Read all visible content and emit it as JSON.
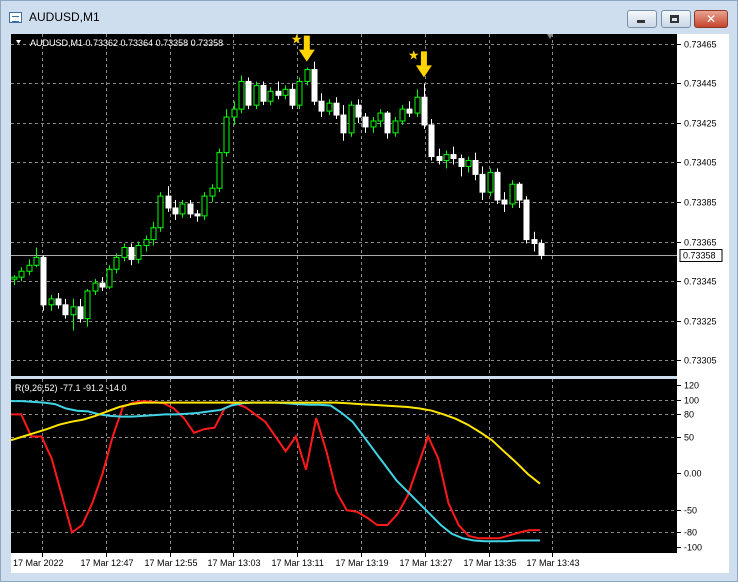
{
  "window": {
    "title": "AUDUSD,M1"
  },
  "chart_data": [
    {
      "type": "candlestick",
      "header": "AUDUSD,M1  0.73362 0.73364 0.73358 0.73358",
      "y_ticks": [
        "0.73465",
        "0.73445",
        "0.73425",
        "0.73405",
        "0.73385",
        "0.73365",
        "0.73345",
        "0.73325",
        "0.73305"
      ],
      "ylim": [
        0.73297,
        0.7347
      ],
      "current_price": "0.73358",
      "x_ticks": [
        "17 Mar 2022",
        "17 Mar 12:47",
        "17 Mar 12:55",
        "17 Mar 13:03",
        "17 Mar 13:11",
        "17 Mar 13:19",
        "17 Mar 13:27",
        "17 Mar 13:35",
        "17 Mar 13:43"
      ],
      "grid": true,
      "colors": {
        "bull": "#00ff00",
        "bear": "#ffffff",
        "bg": "#000000",
        "signal": "#ffd400"
      },
      "signals": [
        {
          "index": 40
        },
        {
          "index": 56
        }
      ],
      "candles": [
        [
          0.73346,
          0.73348,
          0.73343,
          0.73347
        ],
        [
          0.73347,
          0.73352,
          0.73345,
          0.7335
        ],
        [
          0.7335,
          0.73356,
          0.73348,
          0.73353
        ],
        [
          0.73353,
          0.73362,
          0.73352,
          0.73357
        ],
        [
          0.73357,
          0.73358,
          0.7333,
          0.73333
        ],
        [
          0.73333,
          0.73338,
          0.7333,
          0.73336
        ],
        [
          0.73336,
          0.73339,
          0.73331,
          0.73333
        ],
        [
          0.73333,
          0.73336,
          0.73326,
          0.73328
        ],
        [
          0.73328,
          0.73336,
          0.7332,
          0.73332
        ],
        [
          0.73332,
          0.73336,
          0.73324,
          0.73326
        ],
        [
          0.73326,
          0.73341,
          0.73322,
          0.7334
        ],
        [
          0.7334,
          0.73346,
          0.73338,
          0.73344
        ],
        [
          0.73344,
          0.73347,
          0.7334,
          0.73342
        ],
        [
          0.73342,
          0.73353,
          0.73341,
          0.73351
        ],
        [
          0.73351,
          0.73359,
          0.73349,
          0.73357
        ],
        [
          0.73357,
          0.73364,
          0.73355,
          0.73362
        ],
        [
          0.73362,
          0.73364,
          0.73353,
          0.73356
        ],
        [
          0.73356,
          0.73365,
          0.73354,
          0.73363
        ],
        [
          0.73363,
          0.73368,
          0.7336,
          0.73366
        ],
        [
          0.73366,
          0.73375,
          0.73363,
          0.73372
        ],
        [
          0.73372,
          0.7339,
          0.7337,
          0.73388
        ],
        [
          0.73388,
          0.73393,
          0.7338,
          0.73382
        ],
        [
          0.73382,
          0.73386,
          0.73376,
          0.73379
        ],
        [
          0.73379,
          0.73386,
          0.73377,
          0.73384
        ],
        [
          0.73384,
          0.73386,
          0.73377,
          0.73379
        ],
        [
          0.73379,
          0.73381,
          0.73375,
          0.73378
        ],
        [
          0.73378,
          0.7339,
          0.73376,
          0.73388
        ],
        [
          0.73388,
          0.73394,
          0.73385,
          0.73392
        ],
        [
          0.73392,
          0.73412,
          0.7339,
          0.7341
        ],
        [
          0.7341,
          0.73432,
          0.73408,
          0.73428
        ],
        [
          0.73428,
          0.73436,
          0.73424,
          0.73432
        ],
        [
          0.73432,
          0.73449,
          0.7343,
          0.73446
        ],
        [
          0.73446,
          0.73448,
          0.73432,
          0.73434
        ],
        [
          0.73434,
          0.73446,
          0.73432,
          0.73444
        ],
        [
          0.73444,
          0.73446,
          0.73434,
          0.73436
        ],
        [
          0.73436,
          0.73443,
          0.73434,
          0.73441
        ],
        [
          0.73441,
          0.73446,
          0.73437,
          0.73439
        ],
        [
          0.73439,
          0.73444,
          0.73437,
          0.73442
        ],
        [
          0.73442,
          0.73445,
          0.73432,
          0.73434
        ],
        [
          0.73434,
          0.73448,
          0.73432,
          0.73446
        ],
        [
          0.73446,
          0.73453,
          0.73444,
          0.73452
        ],
        [
          0.73452,
          0.73456,
          0.73434,
          0.73436
        ],
        [
          0.73436,
          0.7344,
          0.73428,
          0.73431
        ],
        [
          0.73431,
          0.73437,
          0.73429,
          0.73435
        ],
        [
          0.73435,
          0.73438,
          0.73427,
          0.73429
        ],
        [
          0.73429,
          0.73434,
          0.73416,
          0.7342
        ],
        [
          0.7342,
          0.73436,
          0.73418,
          0.73434
        ],
        [
          0.73434,
          0.73437,
          0.73425,
          0.73428
        ],
        [
          0.73428,
          0.7343,
          0.7342,
          0.73423
        ],
        [
          0.73423,
          0.73428,
          0.7342,
          0.73426
        ],
        [
          0.73426,
          0.73432,
          0.73423,
          0.7343
        ],
        [
          0.7343,
          0.73431,
          0.73417,
          0.7342
        ],
        [
          0.7342,
          0.73428,
          0.73418,
          0.73426
        ],
        [
          0.73426,
          0.73434,
          0.73424,
          0.73432
        ],
        [
          0.73432,
          0.73436,
          0.73428,
          0.7343
        ],
        [
          0.7343,
          0.73442,
          0.73428,
          0.73438
        ],
        [
          0.73438,
          0.73445,
          0.73422,
          0.73424
        ],
        [
          0.73424,
          0.73427,
          0.73406,
          0.73408
        ],
        [
          0.73408,
          0.73412,
          0.73404,
          0.73406
        ],
        [
          0.73406,
          0.73411,
          0.73402,
          0.73409
        ],
        [
          0.73409,
          0.73413,
          0.73404,
          0.73407
        ],
        [
          0.73407,
          0.73409,
          0.73398,
          0.73403
        ],
        [
          0.73403,
          0.73408,
          0.734,
          0.73406
        ],
        [
          0.73406,
          0.7341,
          0.73396,
          0.73399
        ],
        [
          0.73399,
          0.73403,
          0.73386,
          0.7339
        ],
        [
          0.7339,
          0.73402,
          0.73388,
          0.734
        ],
        [
          0.734,
          0.73402,
          0.73384,
          0.73386
        ],
        [
          0.73386,
          0.7339,
          0.7338,
          0.73384
        ],
        [
          0.73384,
          0.73396,
          0.73382,
          0.73394
        ],
        [
          0.73394,
          0.73395,
          0.73382,
          0.73386
        ],
        [
          0.73386,
          0.73388,
          0.73364,
          0.73366
        ],
        [
          0.73366,
          0.7337,
          0.7336,
          0.73364
        ],
        [
          0.73364,
          0.73366,
          0.73356,
          0.73358
        ]
      ]
    },
    {
      "type": "line",
      "header": "R(9,26,52) -77.1 -91.2 -14.0",
      "y_ticks": [
        "120",
        "100",
        "80",
        "50",
        "0.00",
        "-50",
        "-80",
        "-100"
      ],
      "y_tick_values": [
        120,
        100,
        80,
        50,
        0,
        -50,
        -80,
        -100
      ],
      "ylim": [
        -108,
        128
      ],
      "levels": [
        100,
        80,
        50,
        -50,
        -80
      ],
      "series": [
        {
          "color": "#ff1a1a",
          "values": [
            80,
            80,
            50,
            50,
            20,
            -30,
            -80,
            -70,
            -40,
            0,
            50,
            90,
            96,
            98,
            97,
            95,
            88,
            75,
            55,
            60,
            62,
            88,
            95,
            90,
            80,
            70,
            50,
            30,
            50,
            5,
            75,
            30,
            -25,
            -50,
            -52,
            -60,
            -70,
            -70,
            -55,
            -30,
            10,
            50,
            20,
            -40,
            -70,
            -85,
            -88,
            -88,
            -88,
            -84,
            -80,
            -77,
            -77
          ]
        },
        {
          "color": "#3fd4e6",
          "values": [
            98,
            98,
            97,
            96,
            94,
            88,
            85,
            84,
            80,
            78,
            77,
            77,
            78,
            79,
            80,
            80,
            81,
            82,
            84,
            86,
            92,
            95,
            96,
            96,
            96,
            95,
            94,
            93,
            93,
            92,
            82,
            70,
            50,
            30,
            10,
            -10,
            -25,
            -40,
            -55,
            -70,
            -82,
            -88,
            -91,
            -92,
            -92,
            -92,
            -91,
            -91,
            -91
          ]
        },
        {
          "color": "#ffe600",
          "values": [
            45,
            50,
            55,
            60,
            66,
            70,
            73,
            78,
            84,
            90,
            94,
            96,
            96,
            96,
            96,
            96,
            96,
            96,
            96,
            96,
            96,
            96,
            96,
            96,
            96,
            96,
            96,
            96,
            95,
            94,
            93,
            92,
            91,
            90,
            88,
            85,
            80,
            74,
            66,
            56,
            45,
            30,
            15,
            -1,
            -14
          ]
        }
      ]
    }
  ]
}
